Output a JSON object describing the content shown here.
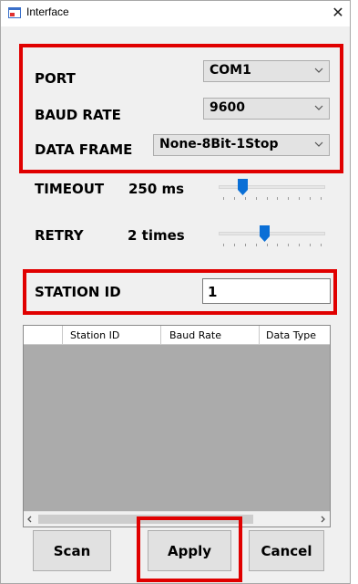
{
  "window": {
    "title": "Interface",
    "close_glyph": "✕"
  },
  "settings": {
    "port": {
      "label": "PORT",
      "value": "COM1"
    },
    "baud_rate": {
      "label": "BAUD RATE",
      "value": "9600"
    },
    "data_frame": {
      "label": "DATA FRAME",
      "value": "None-8Bit-1Stop"
    }
  },
  "timeout": {
    "label": "TIMEOUT",
    "value": "250 ms",
    "slider_fraction": 0.2
  },
  "retry": {
    "label": "RETRY",
    "value": "2 times",
    "slider_fraction": 0.42
  },
  "station": {
    "label": "STATION ID",
    "value": "1"
  },
  "grid": {
    "columns": [
      "Station ID",
      "Baud Rate",
      "Data Type"
    ]
  },
  "buttons": {
    "scan": "Scan",
    "apply": "Apply",
    "cancel": "Cancel"
  },
  "colors": {
    "highlight_red": "#e00000",
    "slider_blue": "#0a6fd6",
    "grid_gray": "#ababab"
  },
  "icons": [
    "app-window-icon",
    "close-icon",
    "chevron-down-icon",
    "slider-thumb-icon",
    "scroll-left-icon",
    "scroll-right-icon"
  ]
}
